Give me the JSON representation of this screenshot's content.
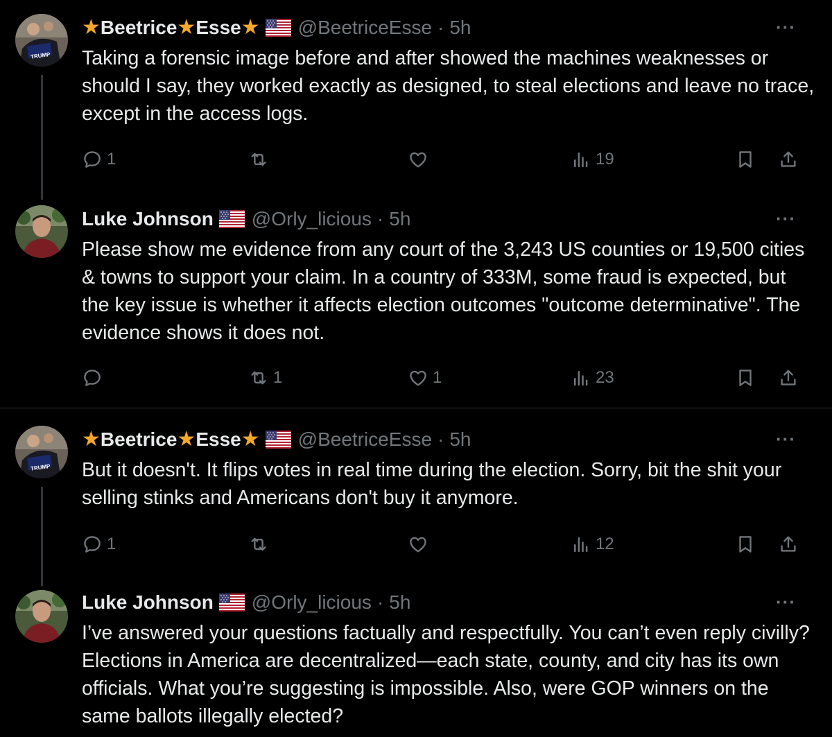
{
  "tweets": [
    {
      "name_a": "Beetrice",
      "name_b": "Esse",
      "star": "★",
      "handle": "@BeetriceEsse",
      "separator": "·",
      "time": "5h",
      "more": "···",
      "text": "Taking a forensic image before and after showed the machines weaknesses or should I say, they worked exactly as designed, to steal elections and leave no trace, except in the access logs.",
      "reply_count": "1",
      "retweet_count": "",
      "like_count": "",
      "view_count": "19"
    },
    {
      "name": "Luke Johnson",
      "handle": "@Orly_licious",
      "separator": "·",
      "time": "5h",
      "more": "···",
      "text": "Please show me evidence from any court of the 3,243 US counties or 19,500 cities & towns to support your claim. In a country of 333M, some fraud is expected, but the key issue is whether it affects election outcomes \"outcome determinative\". The evidence shows it does not.",
      "reply_count": "",
      "retweet_count": "1",
      "like_count": "1",
      "view_count": "23"
    },
    {
      "name_a": "Beetrice",
      "name_b": "Esse",
      "star": "★",
      "handle": "@BeetriceEsse",
      "separator": "·",
      "time": "5h",
      "more": "···",
      "text": "But it doesn't. It flips votes in real time during the election. Sorry, bit the shit your selling stinks and Americans don't buy it anymore.",
      "reply_count": "1",
      "retweet_count": "",
      "like_count": "",
      "view_count": "12"
    },
    {
      "name": "Luke Johnson",
      "handle": "@Orly_licious",
      "separator": "·",
      "time": "5h",
      "more": "···",
      "text": "I’ve answered your questions factually and respectfully. You can’t even reply civilly? Elections in America are decentralized—each state, county, and city has its own officials. What you’re suggesting is impossible. Also, were GOP winners on the same ballots illegally elected?"
    }
  ],
  "avatar_sign_text": "TRUMP",
  "colors": {
    "background": "#000000",
    "text": "#e7e9ea",
    "muted": "#71767b",
    "divider": "#2f3336",
    "star": "#f4a72a"
  },
  "icons": [
    "reply-icon",
    "retweet-icon",
    "like-icon",
    "views-icon",
    "bookmark-icon",
    "share-icon",
    "star-icon",
    "us-flag-icon",
    "more-icon"
  ]
}
